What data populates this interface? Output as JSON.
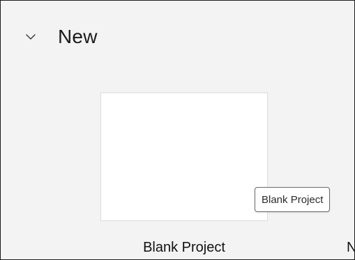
{
  "section": {
    "title": "New",
    "expand_icon": "chevron-down-icon"
  },
  "templates": [
    {
      "label": "Blank Project"
    },
    {
      "label": "N"
    }
  ],
  "tooltip": {
    "text": "Blank Project"
  }
}
